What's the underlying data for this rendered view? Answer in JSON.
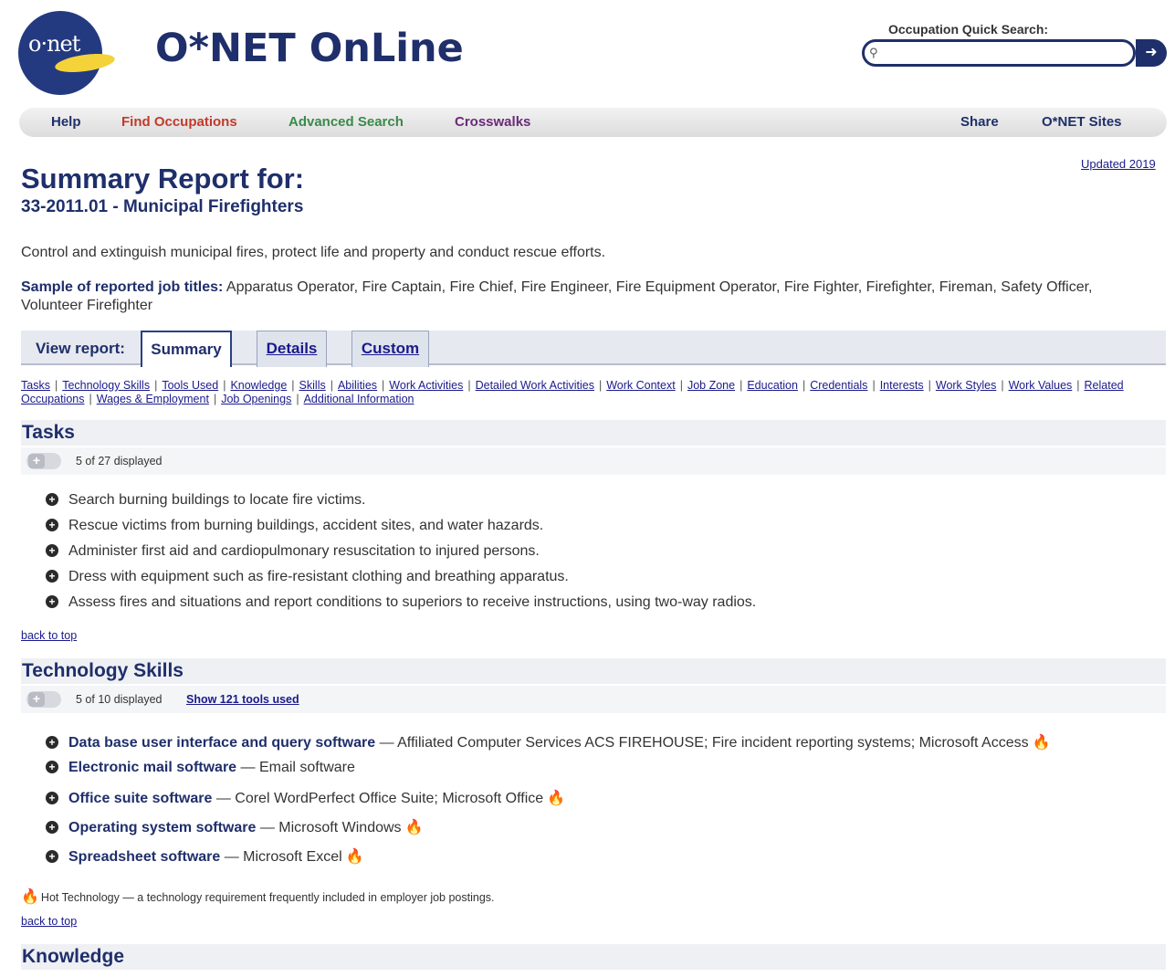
{
  "header": {
    "logo_text": "o·net",
    "site_title": "O*NET OnLine",
    "quick_search_label": "Occupation Quick Search:",
    "quick_search_placeholder": ""
  },
  "nav": {
    "help": "Help",
    "find": "Find Occupations",
    "advanced": "Advanced Search",
    "crosswalks": "Crosswalks",
    "share": "Share",
    "sites": "O*NET Sites"
  },
  "updated": "Updated 2019",
  "report": {
    "heading": "Summary Report for:",
    "subtitle": "33-2011.01 - Municipal Firefighters",
    "description": "Control and extinguish municipal fires, protect life and property and conduct rescue efforts.",
    "sample_label": "Sample of reported job titles:",
    "sample_titles": " Apparatus Operator, Fire Captain, Fire Chief, Fire Engineer, Fire Equipment Operator, Fire Fighter, Firefighter, Fireman, Safety Officer, Volunteer Firefighter"
  },
  "view_report": {
    "label": "View report:",
    "tabs": [
      "Summary",
      "Details",
      "Custom"
    ]
  },
  "section_links": [
    "Tasks",
    "Technology Skills",
    "Tools Used",
    "Knowledge",
    "Skills",
    "Abilities",
    "Work Activities",
    "Detailed Work Activities",
    "Work Context",
    "Job Zone",
    "Education",
    "Credentials",
    "Interests",
    "Work Styles",
    "Work Values",
    "Related Occupations",
    "Wages & Employment",
    "Job Openings",
    "Additional Information"
  ],
  "tasks": {
    "title": "Tasks",
    "count": "5 of 27 displayed",
    "items": [
      "Search burning buildings to locate fire victims.",
      "Rescue victims from burning buildings, accident sites, and water hazards.",
      "Administer first aid and cardiopulmonary resuscitation to injured persons.",
      "Dress with equipment such as fire-resistant clothing and breathing apparatus.",
      "Assess fires and situations and report conditions to superiors to receive instructions, using two-way radios."
    ]
  },
  "back_to_top": "back to top",
  "tech": {
    "title": "Technology Skills",
    "count": "5 of 10 displayed",
    "show_tools": "Show 121 tools used",
    "items": [
      {
        "category": "Data base user interface and query software",
        "examples": " — Affiliated Computer Services ACS FIREHOUSE; Fire incident reporting systems; Microsoft Access"
      },
      {
        "category": "Electronic mail software",
        "examples": " — Email software"
      },
      {
        "category": "Office suite software",
        "examples": " — Corel WordPerfect Office Suite; Microsoft Office"
      },
      {
        "category": "Operating system software",
        "examples": " — Microsoft Windows"
      },
      {
        "category": "Spreadsheet software",
        "examples": " — Microsoft Excel"
      }
    ],
    "hot_note": "Hot Technology — a technology requirement frequently included in employer job postings."
  },
  "knowledge": {
    "title": "Knowledge"
  },
  "colors": {
    "brand_navy": "#1f2f6b",
    "find_red": "#c23a2a",
    "advanced_green": "#3a8a4a",
    "crosswalks_purple": "#6a2a7a",
    "hot_flame": "#e04a1a"
  }
}
